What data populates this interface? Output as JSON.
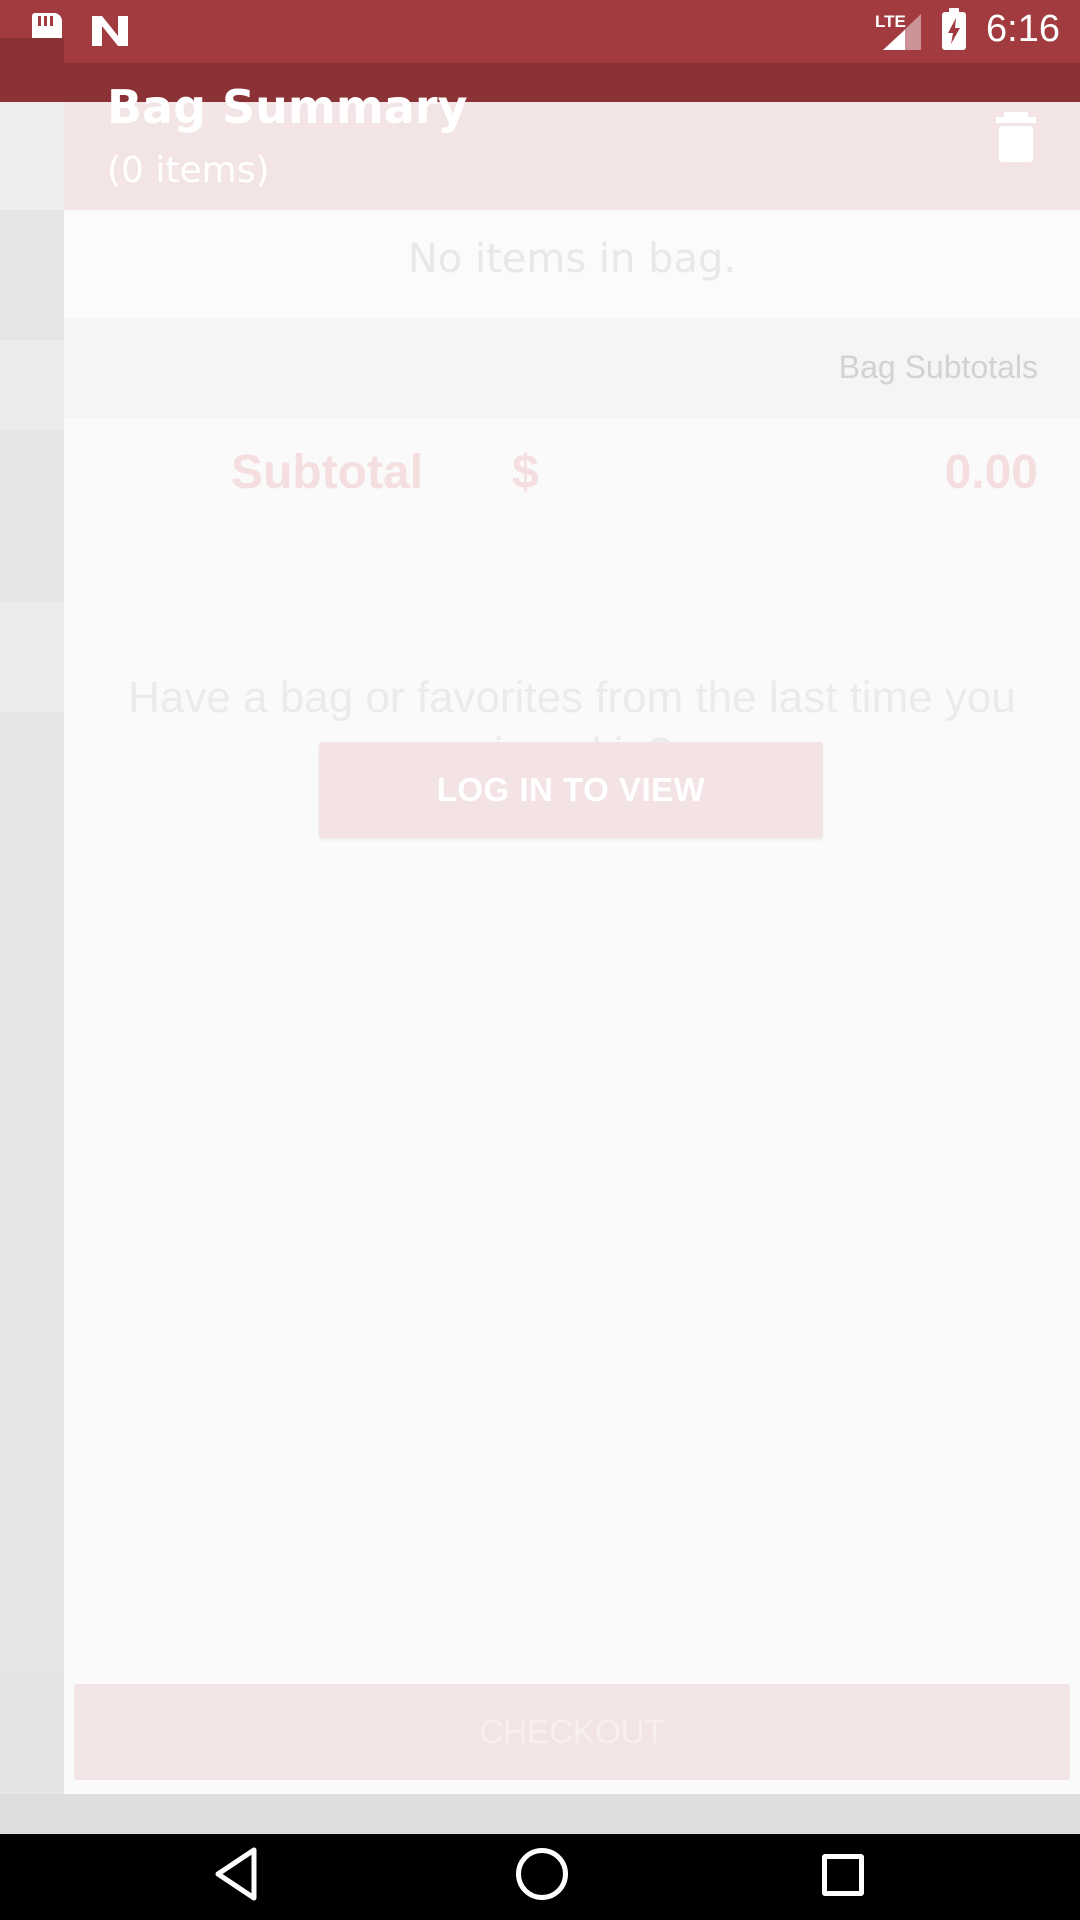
{
  "status_bar": {
    "network": "LTE",
    "time": "6:16",
    "icons": [
      "sd-card-icon",
      "n-notification-icon",
      "signal-icon",
      "battery-charging-icon"
    ]
  },
  "header": {
    "title": "Bag Summary",
    "item_count": "(0 items)",
    "trash_icon": "trash-icon"
  },
  "bag": {
    "empty_message": "No items in bag."
  },
  "subtotals": {
    "section_label": "Bag Subtotals",
    "subtotal_label": "Subtotal",
    "currency": "$",
    "subtotal_value": "0.00"
  },
  "login": {
    "prompt": "Have a bag or favorites from the last time you signed in?",
    "button_label": "LOG IN TO VIEW"
  },
  "checkout": {
    "button_label": "CHECKOUT"
  },
  "nav": {
    "icons": [
      "back-icon",
      "home-icon",
      "recent-apps-icon"
    ]
  },
  "colors": {
    "status_bar": "#a23b40",
    "accent_pale": "#f3e4e5"
  }
}
